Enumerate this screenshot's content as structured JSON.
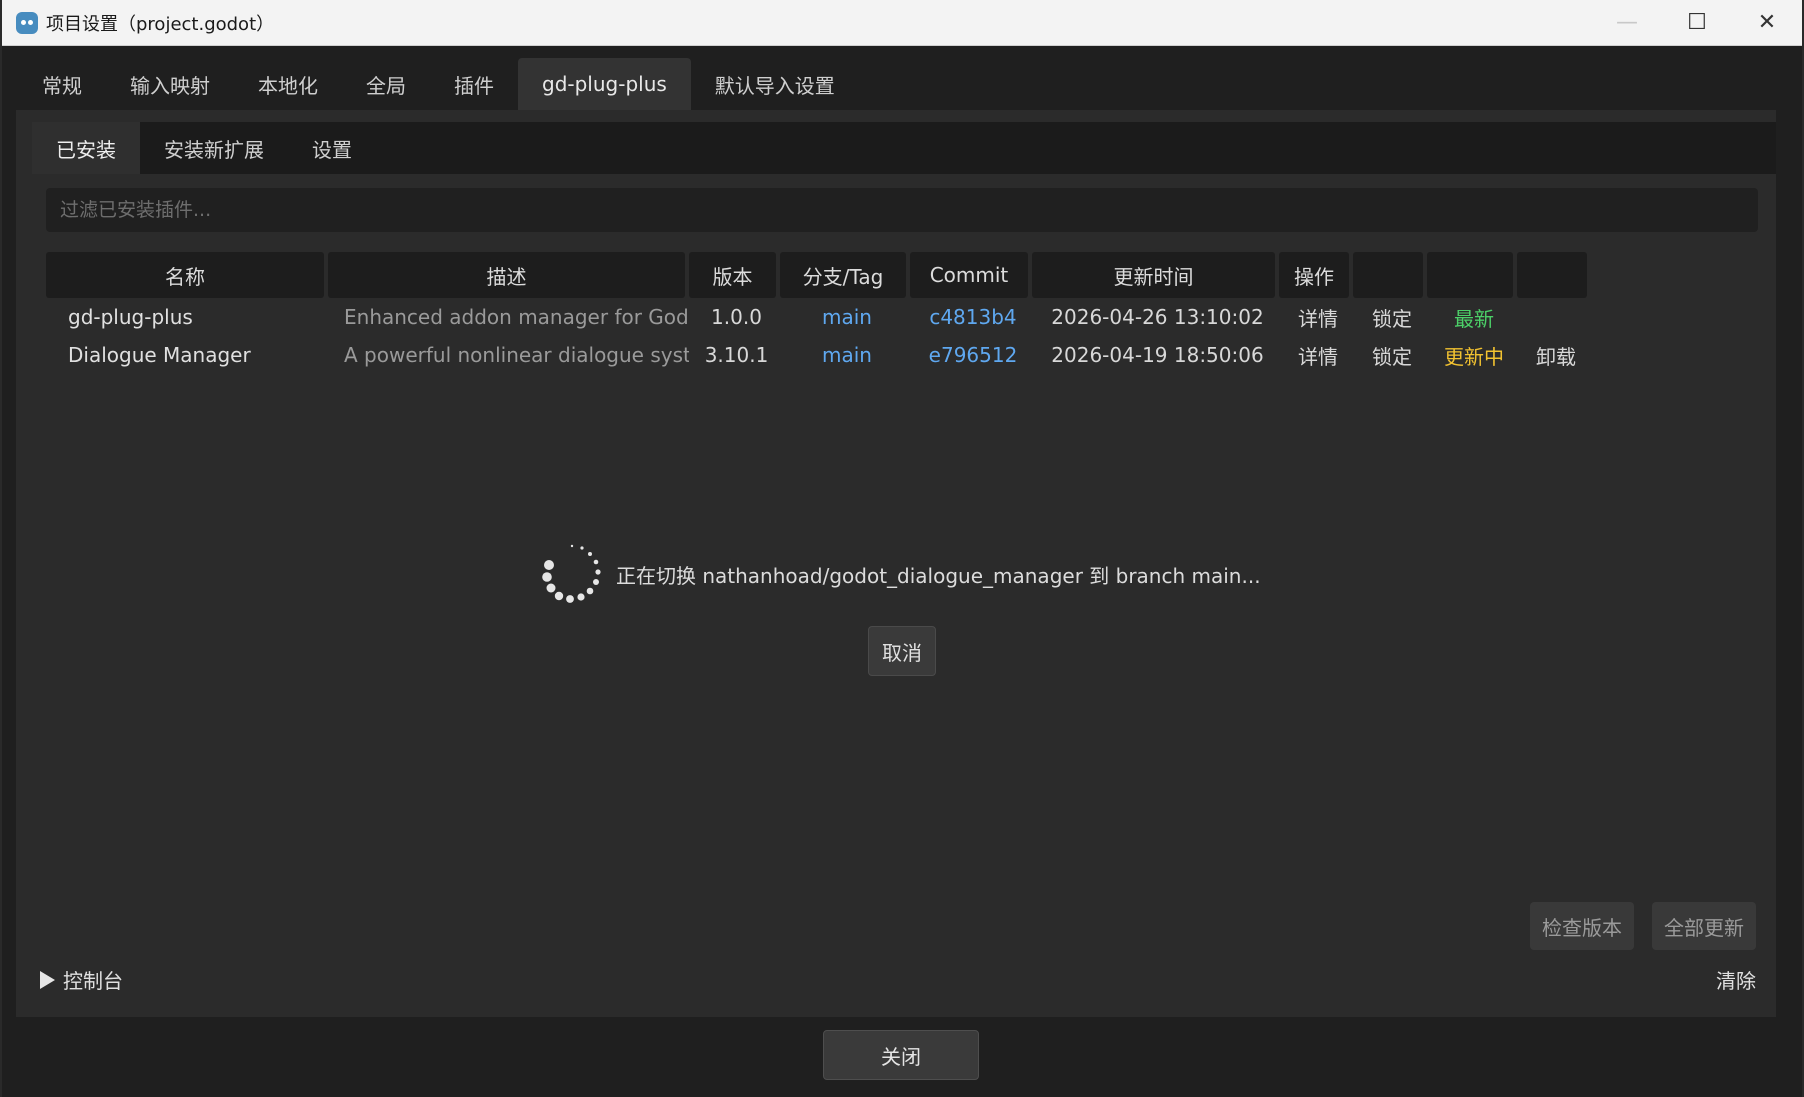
{
  "window": {
    "title": "项目设置（project.godot）",
    "controls": {
      "minimize": "—",
      "maximize": "☐",
      "close": "✕"
    }
  },
  "top_tabs": [
    {
      "label": "常规",
      "active": false
    },
    {
      "label": "输入映射",
      "active": false
    },
    {
      "label": "本地化",
      "active": false
    },
    {
      "label": "全局",
      "active": false
    },
    {
      "label": "插件",
      "active": false
    },
    {
      "label": "gd-plug-plus",
      "active": true
    },
    {
      "label": "默认导入设置",
      "active": false
    }
  ],
  "sub_tabs": [
    {
      "label": "已安装",
      "active": true
    },
    {
      "label": "安装新扩展",
      "active": false
    },
    {
      "label": "设置",
      "active": false
    }
  ],
  "filter": {
    "placeholder": "过滤已安装插件..."
  },
  "table": {
    "headers": [
      "名称",
      "描述",
      "版本",
      "分支/Tag",
      "Commit",
      "更新时间",
      "操作",
      "",
      "",
      ""
    ],
    "rows": [
      {
        "name": "gd-plug-plus",
        "description": "Enhanced addon manager for Godot ...",
        "version": "1.0.0",
        "branch": "main",
        "commit": "c4813b4",
        "updated": "2026-04-26 13:10:02",
        "details": "详情",
        "lock": "锁定",
        "status": "最新",
        "status_color": "#4cd068",
        "uninstall": ""
      },
      {
        "name": "Dialogue Manager",
        "description": "A powerful nonlinear dialogue system",
        "version": "3.10.1",
        "branch": "main",
        "commit": "e796512",
        "updated": "2026-04-19 18:50:06",
        "details": "详情",
        "lock": "锁定",
        "status": "更新中",
        "status_color": "#f2c230",
        "uninstall": "卸载"
      }
    ]
  },
  "loading": {
    "message": "正在切换 nathanhoad/godot_dialogue_manager 到 branch main...",
    "cancel_label": "取消"
  },
  "actions": {
    "check_versions": "检查版本",
    "update_all": "全部更新"
  },
  "console": {
    "label": "控制台",
    "clear_label": "清除"
  },
  "footer": {
    "close_label": "关闭"
  },
  "colors": {
    "link": "#5fa8f0",
    "background": "#2b2b2b"
  }
}
